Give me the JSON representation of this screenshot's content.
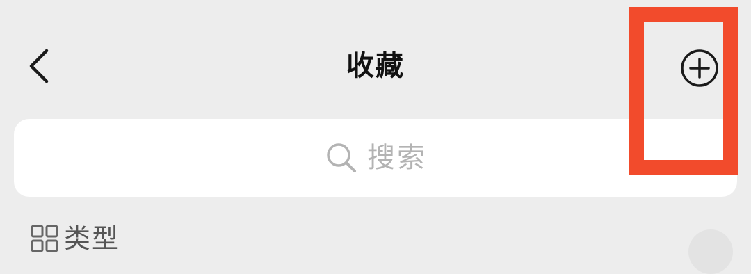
{
  "nav": {
    "title": "收藏",
    "back_icon": "chevron-left-icon",
    "add_icon": "plus-circle-icon"
  },
  "search": {
    "placeholder": "搜索",
    "icon": "search-icon"
  },
  "category": {
    "icon": "grid-icon",
    "label": "类型"
  },
  "colors": {
    "background": "#ededed",
    "search_bg": "#ffffff",
    "highlight": "#f24b2c",
    "title": "#111111",
    "placeholder": "#b3b3b3"
  }
}
